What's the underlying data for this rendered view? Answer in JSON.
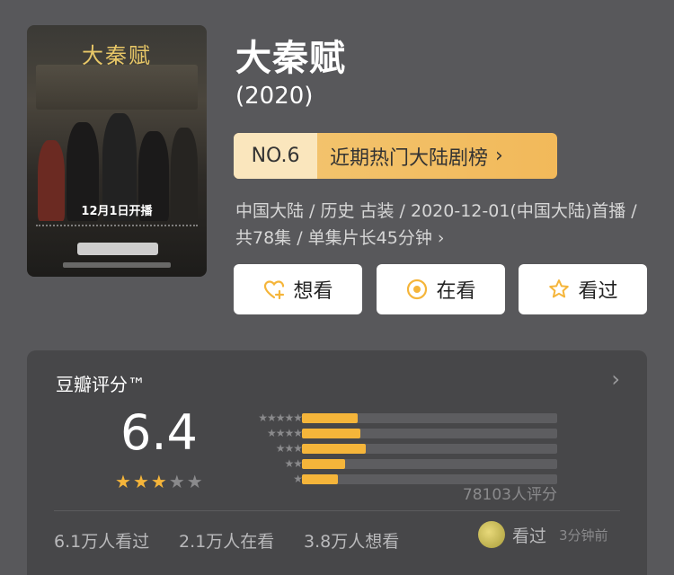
{
  "poster": {
    "title_art": "大秦赋",
    "air_date": "12月1日开播"
  },
  "title": "大秦赋",
  "year": "(2020)",
  "ranking": {
    "number": "NO.6",
    "label": "近期热门大陆剧榜",
    "arrow": "›"
  },
  "meta": {
    "line": "中国大陆 / 历史 古装 / 2020-12-01(中国大陆)首播 / 共78集 / 单集片长45分钟",
    "chevron": "›"
  },
  "actions": {
    "want": "想看",
    "watching": "在看",
    "watched": "看过"
  },
  "rating": {
    "title": "豆瓣评分™",
    "chevron": "›",
    "score": "6.4",
    "stars_on": 3,
    "stars_total": 5,
    "count_text": "78103人评分",
    "distribution": [
      {
        "stars": "★★★★★",
        "fraction": 0.22
      },
      {
        "stars": "★★★★",
        "fraction": 0.23
      },
      {
        "stars": "★★★",
        "fraction": 0.25
      },
      {
        "stars": "★★",
        "fraction": 0.17
      },
      {
        "stars": "★",
        "fraction": 0.14
      }
    ]
  },
  "stats": {
    "watched": "6.1万人看过",
    "watching": "2.1万人在看",
    "want": "3.8万人想看"
  },
  "recent": {
    "action": "看过",
    "time": "3分钟前"
  },
  "colors": {
    "background": "#58585b",
    "card": "#474749",
    "accent": "#f5b53a",
    "rank_bg": "#f2b95a"
  }
}
